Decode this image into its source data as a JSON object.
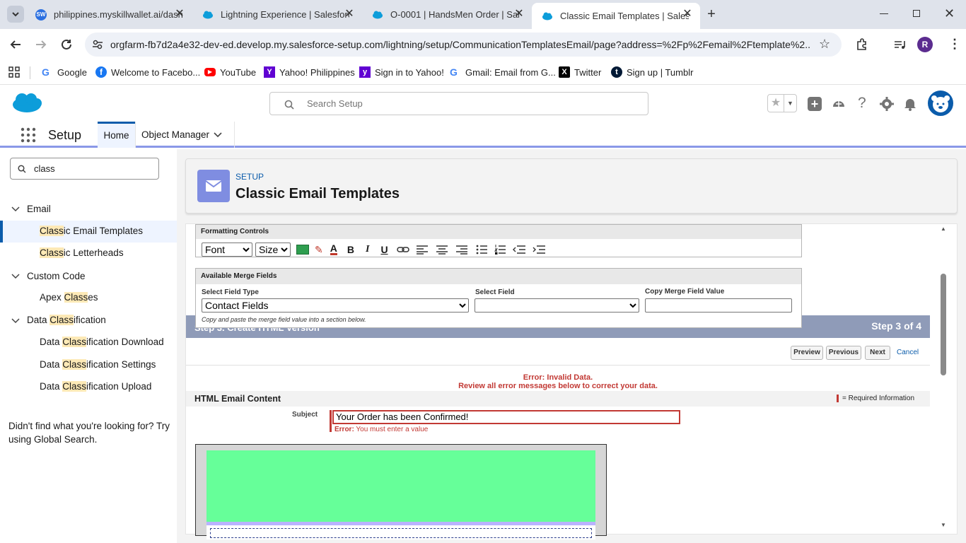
{
  "browser": {
    "tabs": [
      {
        "title": "philippines.myskillwallet.ai/dash",
        "favicon": "skillwallet-icon",
        "active": false
      },
      {
        "title": "Lightning Experience | Salesforce",
        "favicon": "salesforce-cloud-icon",
        "active": false
      },
      {
        "title": "O-0001 | HandsMen Order | Sal",
        "favicon": "salesforce-cloud-icon",
        "active": false
      },
      {
        "title": "Classic Email Templates | Salesfo",
        "favicon": "salesforce-cloud-icon",
        "active": true
      }
    ],
    "url": "orgfarm-fb7d2a4e32-dev-ed.develop.my.salesforce-setup.com/lightning/setup/CommunicationTemplatesEmail/page?address=%2Fp%2Femail%2Ftemplate%2...",
    "profile_initial": "R",
    "bookmarks": [
      {
        "label": "Google",
        "icon": "google-icon"
      },
      {
        "label": "Welcome to Facebo...",
        "icon": "facebook-icon"
      },
      {
        "label": "YouTube",
        "icon": "youtube-icon"
      },
      {
        "label": "Yahoo! Philippines",
        "icon": "yahoo-icon"
      },
      {
        "label": "Sign in to Yahoo!",
        "icon": "yahoo-icon"
      },
      {
        "label": "Gmail: Email from G...",
        "icon": "google-icon"
      },
      {
        "label": "Twitter",
        "icon": "x-icon"
      },
      {
        "label": "Sign up | Tumblr",
        "icon": "tumblr-icon"
      }
    ]
  },
  "header": {
    "search_placeholder": "Search Setup",
    "app_name": "Setup",
    "nav": {
      "home": "Home",
      "object_manager": "Object Manager"
    }
  },
  "sidebar": {
    "quick_find": "class",
    "not_found": "Didn't find what you're looking for? Try using Global Search.",
    "groups": {
      "email": {
        "pre": "Email",
        "hl": "",
        "post": ""
      },
      "email_templates": {
        "pre": "",
        "hl": "Class",
        "post": "ic Email Templates"
      },
      "letterheads": {
        "pre": "",
        "hl": "Class",
        "post": "ic Letterheads"
      },
      "custom_code": {
        "pre": "Custom Code",
        "hl": "",
        "post": ""
      },
      "apex": {
        "pre": "Apex ",
        "hl": "Class",
        "post": "es"
      },
      "data_class": {
        "pre": "Data ",
        "hl": "Class",
        "post": "ification"
      },
      "dc_download": {
        "pre": "Data ",
        "hl": "Class",
        "post": "ification Download"
      },
      "dc_settings": {
        "pre": "Data ",
        "hl": "Class",
        "post": "ification Settings"
      },
      "dc_upload": {
        "pre": "Data ",
        "hl": "Class",
        "post": "ification Upload"
      }
    }
  },
  "page": {
    "eyebrow": "SETUP",
    "title": "Classic Email Templates",
    "formatting_controls": "Formatting Controls",
    "font_label": "Font",
    "size_label": "Size",
    "merge": {
      "title": "Available Merge Fields",
      "field_type_label": "Select Field Type",
      "field_type_value": "Contact Fields",
      "field_label": "Select Field",
      "copy_label": "Copy Merge Field Value",
      "hint": "Copy and paste the merge field value into a section below."
    },
    "step_title_partial": "Step 3. Create HTML Version",
    "step": "Step 3 of 4",
    "buttons": {
      "preview": "Preview",
      "previous": "Previous",
      "next": "Next",
      "cancel": "Cancel"
    },
    "error_line1": "Error: Invalid Data.",
    "error_line2": "Review all error messages below to correct your data.",
    "section_title": "HTML Email Content",
    "required_info": "= Required Information",
    "subject_label": "Subject",
    "subject_value": "Your Order has been Confirmed!",
    "subject_error_prefix": "Error:",
    "subject_error": "You must enter a value"
  },
  "colors": {
    "salesforce_blue": "#0b5cab",
    "brand_cloud": "#0d9dda",
    "email_icon_bg": "#7f8de1",
    "error_red": "#c23934",
    "step_bar": "#8f9bb8",
    "template_green": "#66ff99"
  }
}
